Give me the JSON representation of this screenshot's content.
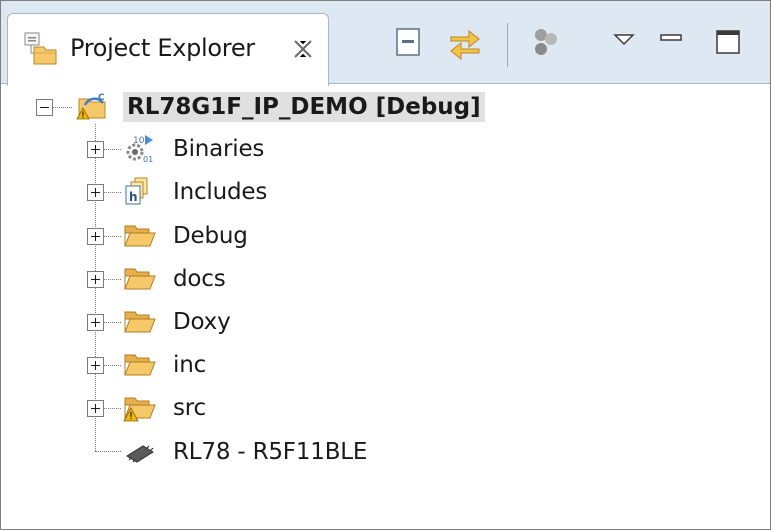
{
  "view": {
    "tab_title": "Project Explorer",
    "tab_icon": "project-explorer-icon",
    "close_icon": "close-icon",
    "toolbar_icons": [
      "collapse-all-icon",
      "link-with-editor-icon",
      "filter-icon",
      "view-menu-icon",
      "minimize-icon",
      "maximize-icon"
    ]
  },
  "tree": {
    "root": {
      "label": "RL78G1F_IP_DEMO [Debug]",
      "icon": "project-warning-icon",
      "expanded": true
    },
    "children": [
      {
        "label": "Binaries",
        "icon": "binaries-icon",
        "expandable": true
      },
      {
        "label": "Includes",
        "icon": "includes-icon",
        "expandable": true
      },
      {
        "label": "Debug",
        "icon": "folder-icon",
        "expandable": true
      },
      {
        "label": "docs",
        "icon": "folder-icon",
        "expandable": true
      },
      {
        "label": "Doxy",
        "icon": "folder-icon",
        "expandable": true
      },
      {
        "label": "inc",
        "icon": "folder-icon",
        "expandable": true
      },
      {
        "label": "src",
        "icon": "folder-warning-icon",
        "expandable": true
      },
      {
        "label": "RL78 - R5F11BLE",
        "icon": "chip-icon",
        "expandable": false
      }
    ]
  },
  "colors": {
    "toolbar_bg": "#dde8f3",
    "root_highlight": "#e0e0e0",
    "folder": "#f5c96a",
    "warning": "#f2b705"
  }
}
